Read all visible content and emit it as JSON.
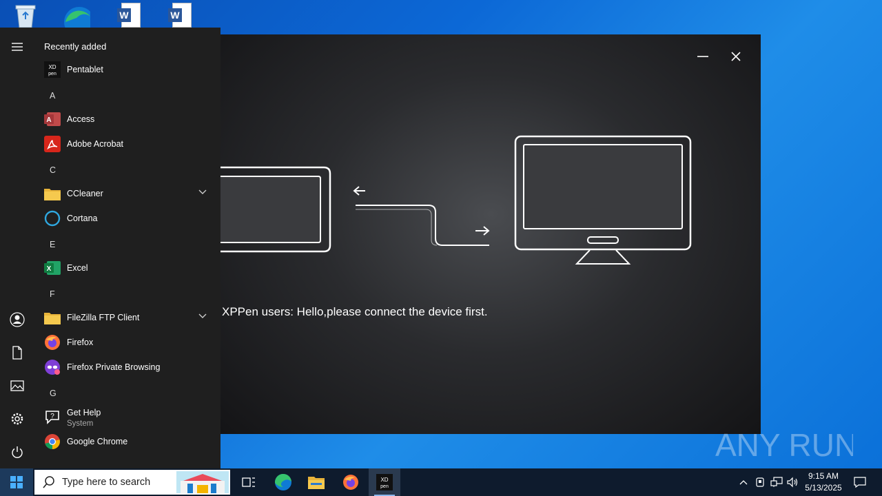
{
  "desktop": {
    "icons": [
      "recycle-bin-icon",
      "edge-icon",
      "word-document-icon",
      "word-document-icon"
    ]
  },
  "app": {
    "message": "XPPen users: Hello,please connect the device first.",
    "colors": {
      "background": "#1a1b1e",
      "line": "#ffffff"
    }
  },
  "start_menu": {
    "section_title": "Recently added",
    "items": [
      {
        "label": "Pentablet",
        "icon": "xppen-icon"
      },
      {
        "letter": "A"
      },
      {
        "label": "Access",
        "icon": "access-icon"
      },
      {
        "label": "Adobe Acrobat",
        "icon": "acrobat-icon"
      },
      {
        "letter": "C"
      },
      {
        "label": "CCleaner",
        "icon": "folder-icon",
        "expandable": true
      },
      {
        "label": "Cortana",
        "icon": "cortana-icon"
      },
      {
        "letter": "E"
      },
      {
        "label": "Excel",
        "icon": "excel-icon"
      },
      {
        "letter": "F"
      },
      {
        "label": "FileZilla FTP Client",
        "icon": "folder-icon",
        "expandable": true
      },
      {
        "label": "Firefox",
        "icon": "firefox-icon"
      },
      {
        "label": "Firefox Private Browsing",
        "icon": "firefox-private-icon"
      },
      {
        "letter": "G"
      },
      {
        "label": "Get Help",
        "sublabel": "System",
        "icon": "get-help-icon"
      },
      {
        "label": "Google Chrome",
        "icon": "chrome-icon"
      }
    ],
    "rail": [
      "hamburger-icon",
      "user-icon",
      "documents-icon",
      "pictures-icon",
      "settings-icon",
      "power-icon"
    ]
  },
  "taskbar": {
    "search_placeholder": "Type here to search",
    "pinned": [
      "task-view-icon",
      "edge-icon",
      "file-explorer-icon",
      "firefox-icon",
      "xppen-icon"
    ],
    "clock": {
      "time": "9:15 AM",
      "date": "5/13/2025"
    }
  },
  "watermark": {
    "text": "ANY RUN"
  }
}
